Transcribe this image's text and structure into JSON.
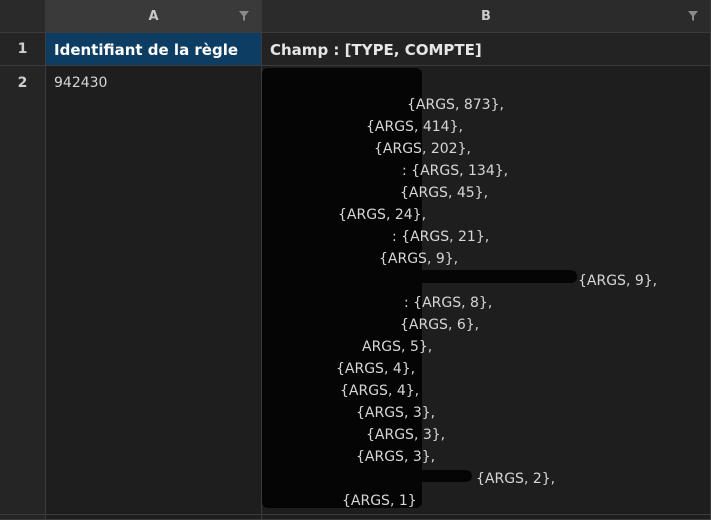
{
  "columns": {
    "a": {
      "letter": "A",
      "filter_icon": "filter-icon"
    },
    "b": {
      "letter": "B",
      "filter_icon": "filter-icon"
    }
  },
  "rows": {
    "r1": "1",
    "r2": "2"
  },
  "header_row": {
    "a": "Identifiant de la règle",
    "b": "Champ : [TYPE, COMPTE]"
  },
  "data_row": {
    "a": "942430",
    "b_visible_entries": [
      "{ARGS, 873},",
      "{ARGS, 414},",
      "{ARGS, 202},",
      ": {ARGS, 134},",
      "{ARGS, 45},",
      "{ARGS, 24},",
      ": {ARGS, 21},",
      "{ARGS, 9},",
      "{ARGS, 9},",
      ": {ARGS, 8},",
      "{ARGS, 6},",
      "ARGS, 5},",
      "{ARGS, 4},",
      "{ARGS, 4},",
      "{ARGS, 3},",
      "{ARGS, 3},",
      "{ARGS, 3},",
      "{ARGS, 2},",
      "{ARGS, 1}"
    ]
  },
  "colors": {
    "header_a_bg": "#0d3d63",
    "background": "#1e1e1e",
    "redaction": "#050505"
  }
}
